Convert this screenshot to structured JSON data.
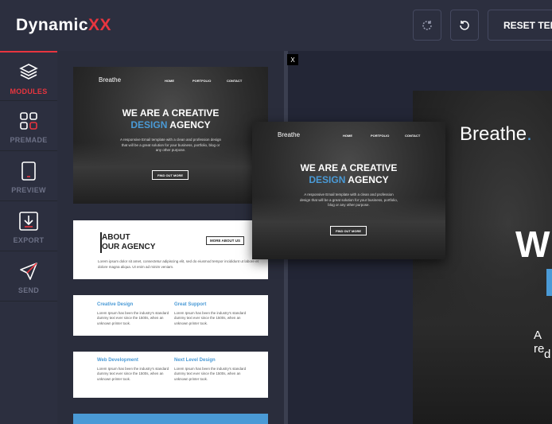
{
  "app": {
    "logo_main": "Dynamic",
    "logo_accent": "XX",
    "accent_color": "#e8353f",
    "blue_color": "#4a9ad6"
  },
  "toolbar": {
    "redo_icon": "refresh-icon",
    "undo_icon": "undo-icon",
    "reset_label": "RESET TEM"
  },
  "sidebar": {
    "items": [
      {
        "label": "MODULES",
        "icon": "layers-icon",
        "active": true
      },
      {
        "label": "PREMADE",
        "icon": "grid-icon",
        "active": false
      },
      {
        "label": "PREVIEW",
        "icon": "tablet-icon",
        "active": false
      },
      {
        "label": "EXPORT",
        "icon": "download-icon",
        "active": false
      },
      {
        "label": "SEND",
        "icon": "paper-plane-icon",
        "active": false
      }
    ]
  },
  "modules": {
    "hero": {
      "brand": "Breathe",
      "nav": [
        "HOME",
        "PORTFOLIO",
        "CONTACT"
      ],
      "headline_white": "WE ARE A CREATIVE",
      "headline_blue": "DESIGN",
      "headline_end": " AGENCY",
      "subtext": "A responsive Email template with a clean and profession design that will be a great solution for your business, portfolio, blog or any other purpose.",
      "cta": "FIND OUT MORE"
    },
    "about": {
      "title_line1": "ABOUT",
      "title_line2": "OUR AGENCY",
      "button": "MORE ABOUT US",
      "text": "Lorem ipsum dolor sit amet, consectetur adipiscing elit, sed do eiusmod tempor incididunt ut labore et dolore magna aliqua. Ut enim ad minim veniam."
    },
    "features1": {
      "left_title": "Creative Design",
      "right_title": "Great Support",
      "text": "Lorem Ipsum has been the industry's standard dummy text ever since the 1500s, when an unknown printer took."
    },
    "features2": {
      "left_title": "Web Development",
      "right_title": "Next Level Design",
      "text": "Lorem Ipsum has been the industry's standard dummy text ever since the 1500s, when an unknown printer took."
    }
  },
  "canvas": {
    "close_label": "X",
    "brand": "Breathe",
    "brand_dot": ".",
    "heading_partial": "W",
    "text_partial_1": "A re",
    "text_partial_2": "d"
  }
}
